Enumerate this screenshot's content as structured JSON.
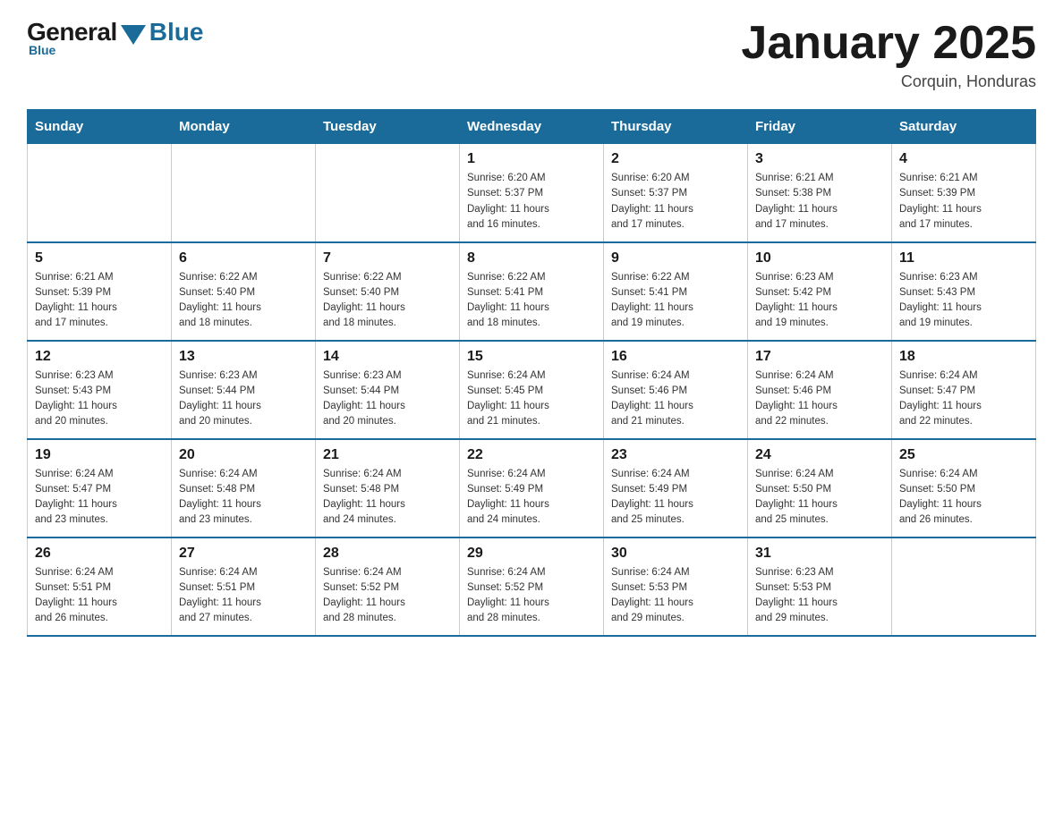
{
  "header": {
    "logo_general": "General",
    "logo_blue": "Blue",
    "month_title": "January 2025",
    "location": "Corquin, Honduras"
  },
  "days_of_week": [
    "Sunday",
    "Monday",
    "Tuesday",
    "Wednesday",
    "Thursday",
    "Friday",
    "Saturday"
  ],
  "weeks": [
    [
      {
        "day": "",
        "info": ""
      },
      {
        "day": "",
        "info": ""
      },
      {
        "day": "",
        "info": ""
      },
      {
        "day": "1",
        "info": "Sunrise: 6:20 AM\nSunset: 5:37 PM\nDaylight: 11 hours\nand 16 minutes."
      },
      {
        "day": "2",
        "info": "Sunrise: 6:20 AM\nSunset: 5:37 PM\nDaylight: 11 hours\nand 17 minutes."
      },
      {
        "day": "3",
        "info": "Sunrise: 6:21 AM\nSunset: 5:38 PM\nDaylight: 11 hours\nand 17 minutes."
      },
      {
        "day": "4",
        "info": "Sunrise: 6:21 AM\nSunset: 5:39 PM\nDaylight: 11 hours\nand 17 minutes."
      }
    ],
    [
      {
        "day": "5",
        "info": "Sunrise: 6:21 AM\nSunset: 5:39 PM\nDaylight: 11 hours\nand 17 minutes."
      },
      {
        "day": "6",
        "info": "Sunrise: 6:22 AM\nSunset: 5:40 PM\nDaylight: 11 hours\nand 18 minutes."
      },
      {
        "day": "7",
        "info": "Sunrise: 6:22 AM\nSunset: 5:40 PM\nDaylight: 11 hours\nand 18 minutes."
      },
      {
        "day": "8",
        "info": "Sunrise: 6:22 AM\nSunset: 5:41 PM\nDaylight: 11 hours\nand 18 minutes."
      },
      {
        "day": "9",
        "info": "Sunrise: 6:22 AM\nSunset: 5:41 PM\nDaylight: 11 hours\nand 19 minutes."
      },
      {
        "day": "10",
        "info": "Sunrise: 6:23 AM\nSunset: 5:42 PM\nDaylight: 11 hours\nand 19 minutes."
      },
      {
        "day": "11",
        "info": "Sunrise: 6:23 AM\nSunset: 5:43 PM\nDaylight: 11 hours\nand 19 minutes."
      }
    ],
    [
      {
        "day": "12",
        "info": "Sunrise: 6:23 AM\nSunset: 5:43 PM\nDaylight: 11 hours\nand 20 minutes."
      },
      {
        "day": "13",
        "info": "Sunrise: 6:23 AM\nSunset: 5:44 PM\nDaylight: 11 hours\nand 20 minutes."
      },
      {
        "day": "14",
        "info": "Sunrise: 6:23 AM\nSunset: 5:44 PM\nDaylight: 11 hours\nand 20 minutes."
      },
      {
        "day": "15",
        "info": "Sunrise: 6:24 AM\nSunset: 5:45 PM\nDaylight: 11 hours\nand 21 minutes."
      },
      {
        "day": "16",
        "info": "Sunrise: 6:24 AM\nSunset: 5:46 PM\nDaylight: 11 hours\nand 21 minutes."
      },
      {
        "day": "17",
        "info": "Sunrise: 6:24 AM\nSunset: 5:46 PM\nDaylight: 11 hours\nand 22 minutes."
      },
      {
        "day": "18",
        "info": "Sunrise: 6:24 AM\nSunset: 5:47 PM\nDaylight: 11 hours\nand 22 minutes."
      }
    ],
    [
      {
        "day": "19",
        "info": "Sunrise: 6:24 AM\nSunset: 5:47 PM\nDaylight: 11 hours\nand 23 minutes."
      },
      {
        "day": "20",
        "info": "Sunrise: 6:24 AM\nSunset: 5:48 PM\nDaylight: 11 hours\nand 23 minutes."
      },
      {
        "day": "21",
        "info": "Sunrise: 6:24 AM\nSunset: 5:48 PM\nDaylight: 11 hours\nand 24 minutes."
      },
      {
        "day": "22",
        "info": "Sunrise: 6:24 AM\nSunset: 5:49 PM\nDaylight: 11 hours\nand 24 minutes."
      },
      {
        "day": "23",
        "info": "Sunrise: 6:24 AM\nSunset: 5:49 PM\nDaylight: 11 hours\nand 25 minutes."
      },
      {
        "day": "24",
        "info": "Sunrise: 6:24 AM\nSunset: 5:50 PM\nDaylight: 11 hours\nand 25 minutes."
      },
      {
        "day": "25",
        "info": "Sunrise: 6:24 AM\nSunset: 5:50 PM\nDaylight: 11 hours\nand 26 minutes."
      }
    ],
    [
      {
        "day": "26",
        "info": "Sunrise: 6:24 AM\nSunset: 5:51 PM\nDaylight: 11 hours\nand 26 minutes."
      },
      {
        "day": "27",
        "info": "Sunrise: 6:24 AM\nSunset: 5:51 PM\nDaylight: 11 hours\nand 27 minutes."
      },
      {
        "day": "28",
        "info": "Sunrise: 6:24 AM\nSunset: 5:52 PM\nDaylight: 11 hours\nand 28 minutes."
      },
      {
        "day": "29",
        "info": "Sunrise: 6:24 AM\nSunset: 5:52 PM\nDaylight: 11 hours\nand 28 minutes."
      },
      {
        "day": "30",
        "info": "Sunrise: 6:24 AM\nSunset: 5:53 PM\nDaylight: 11 hours\nand 29 minutes."
      },
      {
        "day": "31",
        "info": "Sunrise: 6:23 AM\nSunset: 5:53 PM\nDaylight: 11 hours\nand 29 minutes."
      },
      {
        "day": "",
        "info": ""
      }
    ]
  ]
}
